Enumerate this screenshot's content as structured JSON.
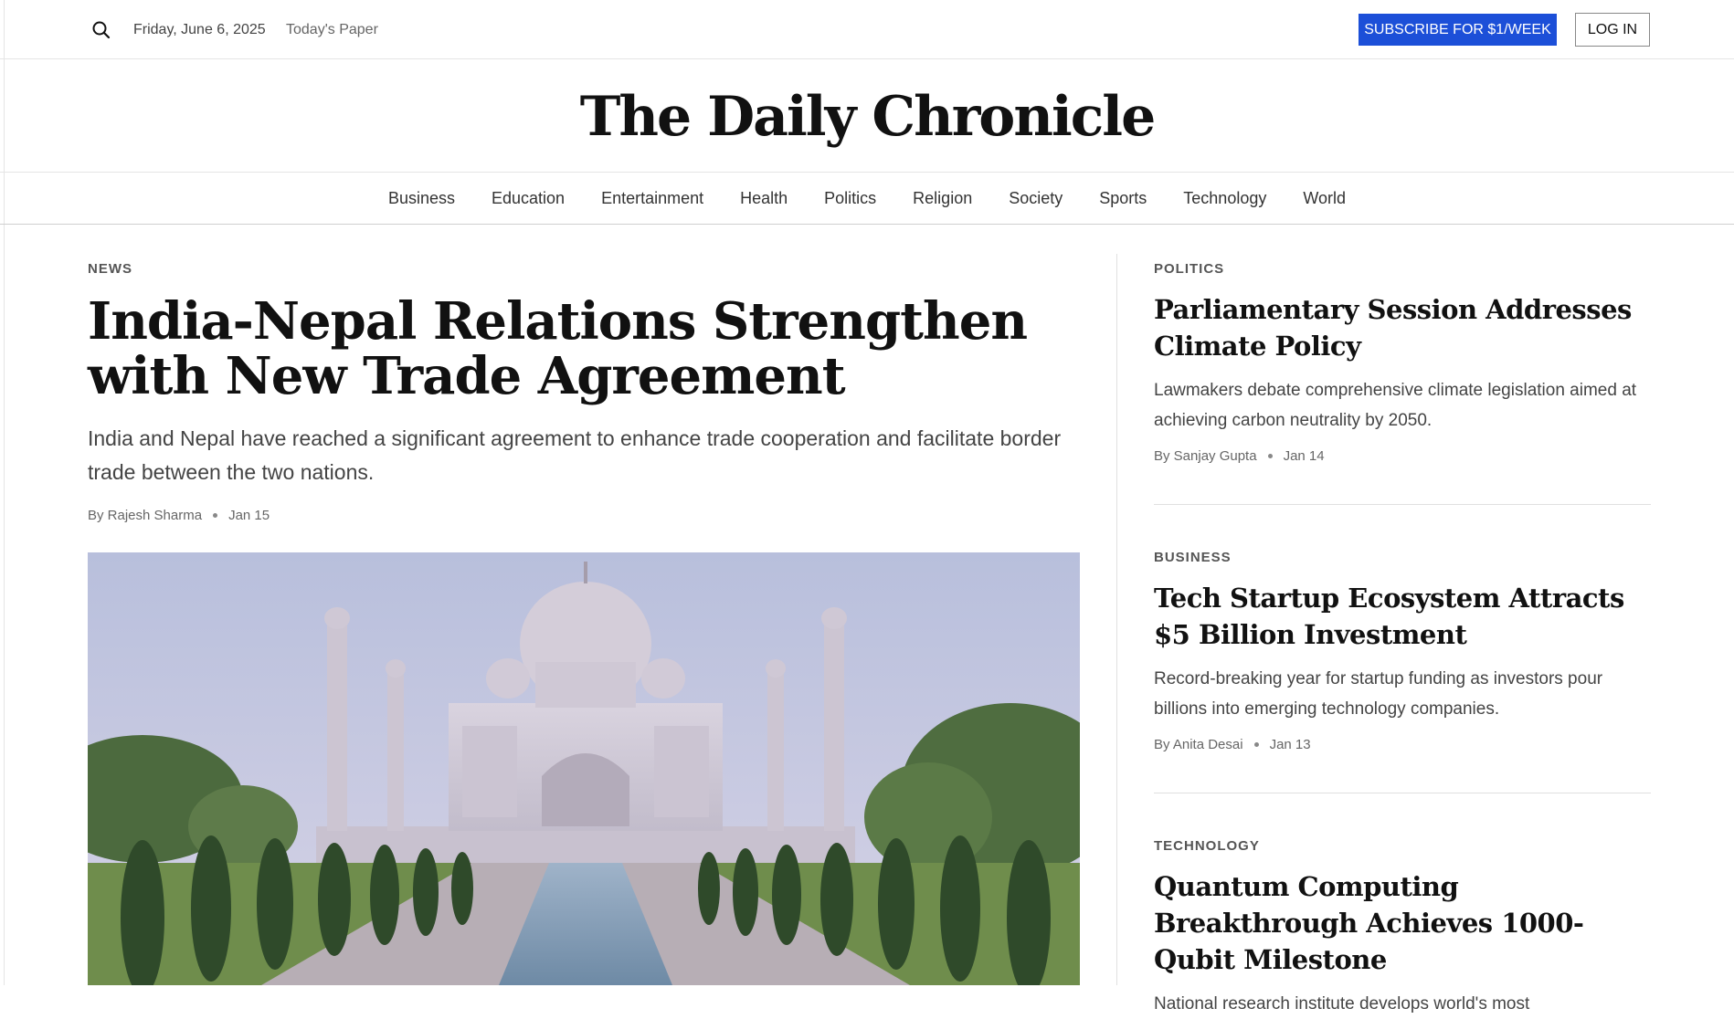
{
  "topbar": {
    "date": "Friday, June 6, 2025",
    "todays_paper": "Today's Paper",
    "subscribe_label": "SUBSCRIBE FOR $1/WEEK",
    "login_label": "LOG IN"
  },
  "masthead": {
    "title": "The Daily Chronicle"
  },
  "nav": {
    "items": [
      "Business",
      "Education",
      "Entertainment",
      "Health",
      "Politics",
      "Religion",
      "Society",
      "Sports",
      "Technology",
      "World"
    ]
  },
  "lead": {
    "kicker": "NEWS",
    "headline": "India-Nepal Relations Strengthen with New Trade Agreement",
    "summary": "India and Nepal have reached a significant agreement to enhance trade cooperation and facilitate border trade between the two nations.",
    "author": "By Rajesh Sharma",
    "date": "Jan 15"
  },
  "sidebar": {
    "stories": [
      {
        "kicker": "POLITICS",
        "headline": "Parliamentary Session Addresses Climate Policy",
        "summary": "Lawmakers debate comprehensive climate legislation aimed at achieving carbon neutrality by 2050.",
        "author": "By Sanjay Gupta",
        "date": "Jan 14"
      },
      {
        "kicker": "BUSINESS",
        "headline": "Tech Startup Ecosystem Attracts $5 Billion Investment",
        "summary": "Record-breaking year for startup funding as investors pour billions into emerging technology companies.",
        "author": "By Anita Desai",
        "date": "Jan 13"
      },
      {
        "kicker": "TECHNOLOGY",
        "headline": "Quantum Computing Breakthrough Achieves 1000-Qubit Milestone",
        "summary": "National research institute develops world's most"
      }
    ]
  },
  "colors": {
    "subscribe_bg": "#1c4fd8",
    "text": "#111111",
    "muted": "#666666"
  },
  "icons": {
    "search": "search-icon"
  }
}
